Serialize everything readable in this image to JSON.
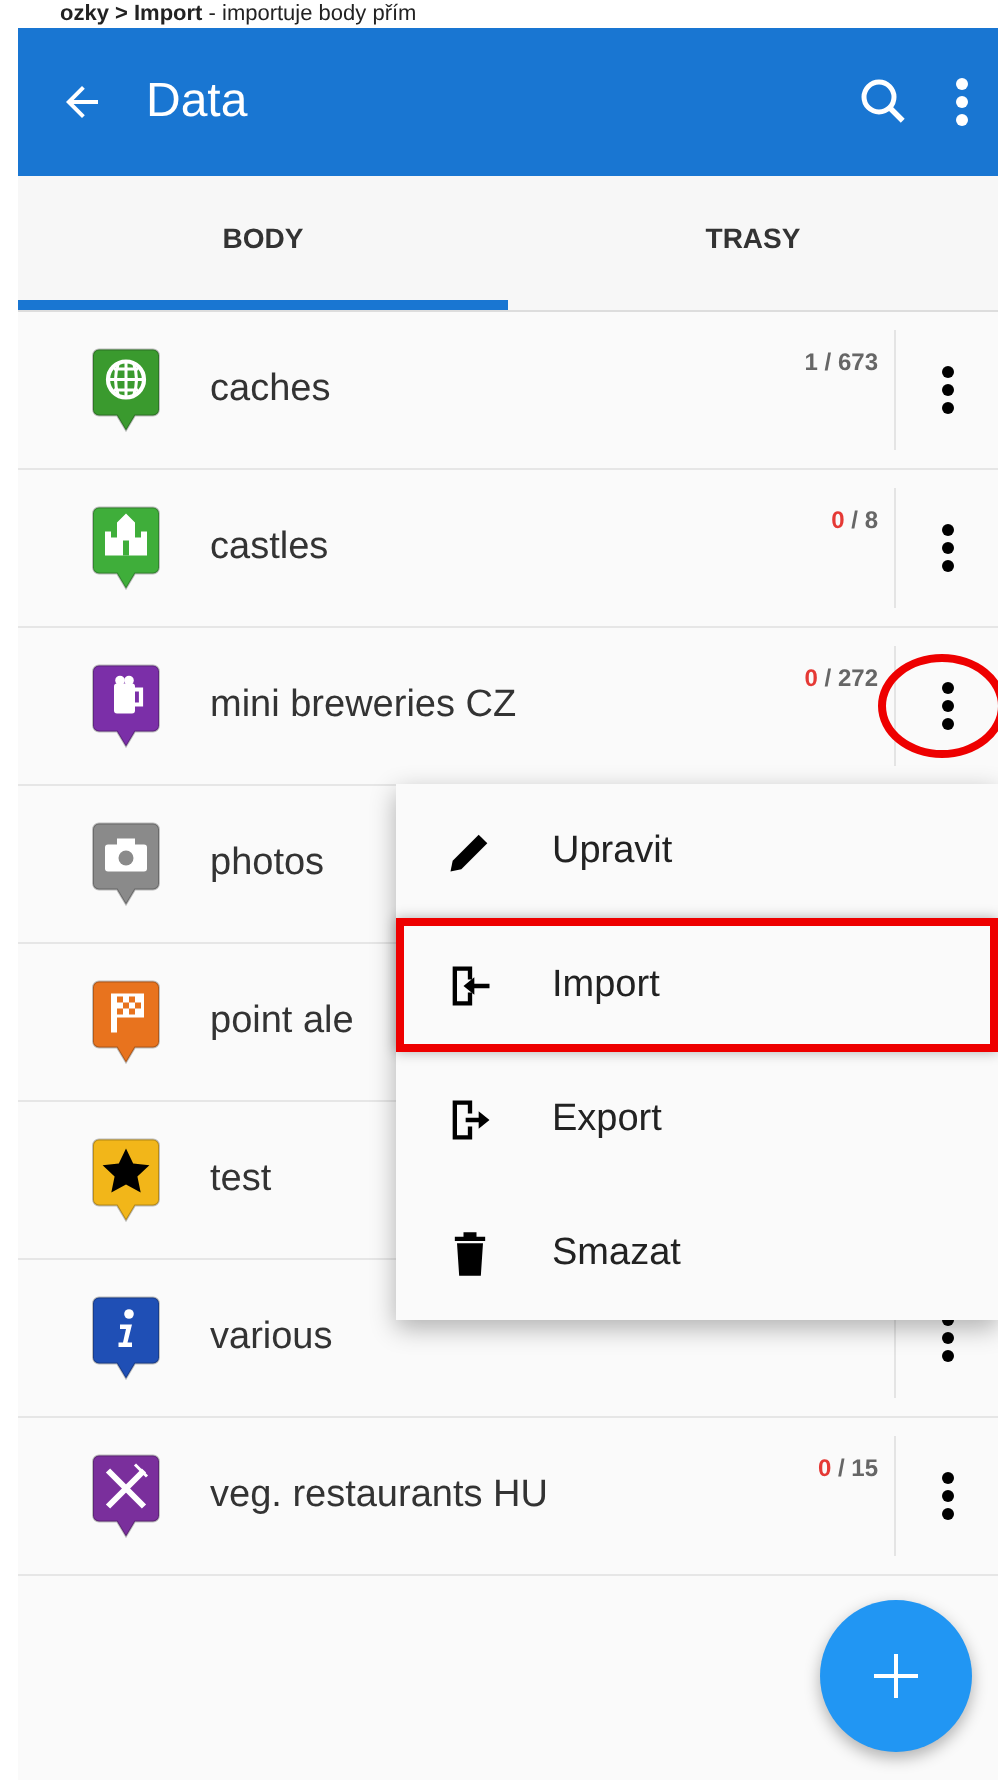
{
  "caption": "**ozky > Import** - importuje body přím",
  "app_bar": {
    "title": "Data"
  },
  "tabs": [
    {
      "label": "BODY",
      "selected": true
    },
    {
      "label": "TRASY",
      "selected": false
    }
  ],
  "rows": [
    {
      "name": "caches",
      "kind": "globe",
      "color": "#3a9a2e",
      "count_selected": "1",
      "count_rest": "/ 673",
      "alert": false,
      "circled": false
    },
    {
      "name": "castles",
      "kind": "castle",
      "color": "#3fae3a",
      "count_selected": "0",
      "count_rest": "/ 8",
      "alert": true,
      "circled": false
    },
    {
      "name": "mini breweries CZ",
      "kind": "beer",
      "color": "#7b2fa8",
      "count_selected": "0",
      "count_rest": "/ 272",
      "alert": true,
      "circled": true
    },
    {
      "name": "photos",
      "kind": "camera",
      "color": "#8a8a8a",
      "circled": false
    },
    {
      "name": "point ale",
      "kind": "flag",
      "color": "#e8731e",
      "circled": false
    },
    {
      "name": "test",
      "kind": "star",
      "color": "#f2b619",
      "circled": false
    },
    {
      "name": "various",
      "kind": "info",
      "color": "#1f4fb5",
      "circled": false
    },
    {
      "name": "veg. restaurants HU",
      "kind": "cutlery",
      "color": "#7a2f9c",
      "count_selected": "0",
      "count_rest": "/ 15",
      "alert": true,
      "circled": false
    }
  ],
  "menu": [
    {
      "label": "Upravit",
      "kind": "edit",
      "highlighted": false
    },
    {
      "label": "Import",
      "kind": "import",
      "highlighted": true
    },
    {
      "label": "Export",
      "kind": "export",
      "highlighted": false
    },
    {
      "label": "Smazat",
      "kind": "delete",
      "highlighted": false
    }
  ]
}
